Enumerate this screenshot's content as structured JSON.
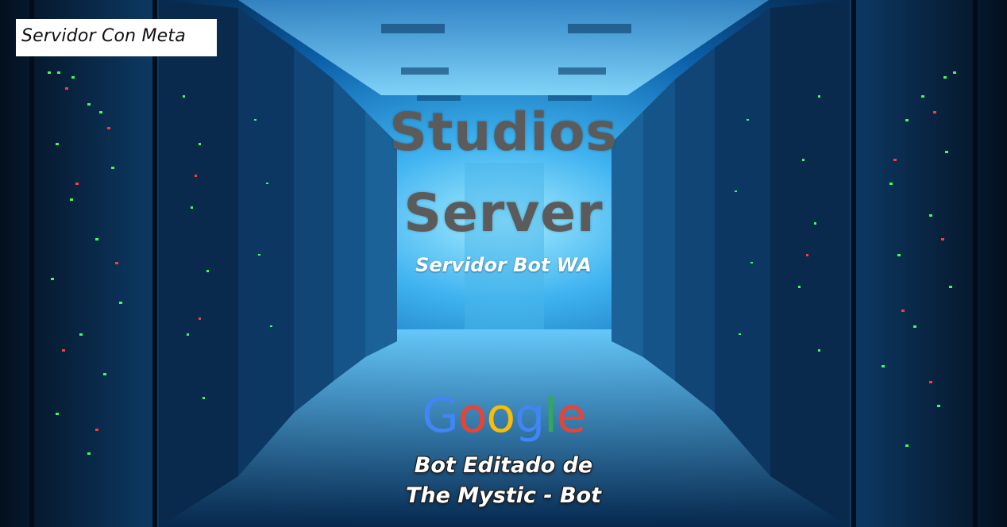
{
  "badge": {
    "text": "Servidor Con Meta"
  },
  "title": {
    "line1": "Studios",
    "line2": "Server"
  },
  "subtitle": "Servidor Bot WA",
  "logo": {
    "letters": [
      "G",
      "o",
      "o",
      "g",
      "l",
      "e"
    ],
    "colors": [
      "#4285f4",
      "#ea4335",
      "#fbbc05",
      "#4285f4",
      "#34a853",
      "#ea4335"
    ]
  },
  "credit": {
    "line1": "Bot Editado de",
    "line2": "The Mystic - Bot"
  },
  "palette": {
    "corridor_light": "#7fd8ff",
    "rack_dark": "#0a1a2e",
    "led_green": "#39ff5a",
    "led_red": "#ff3b3b"
  }
}
